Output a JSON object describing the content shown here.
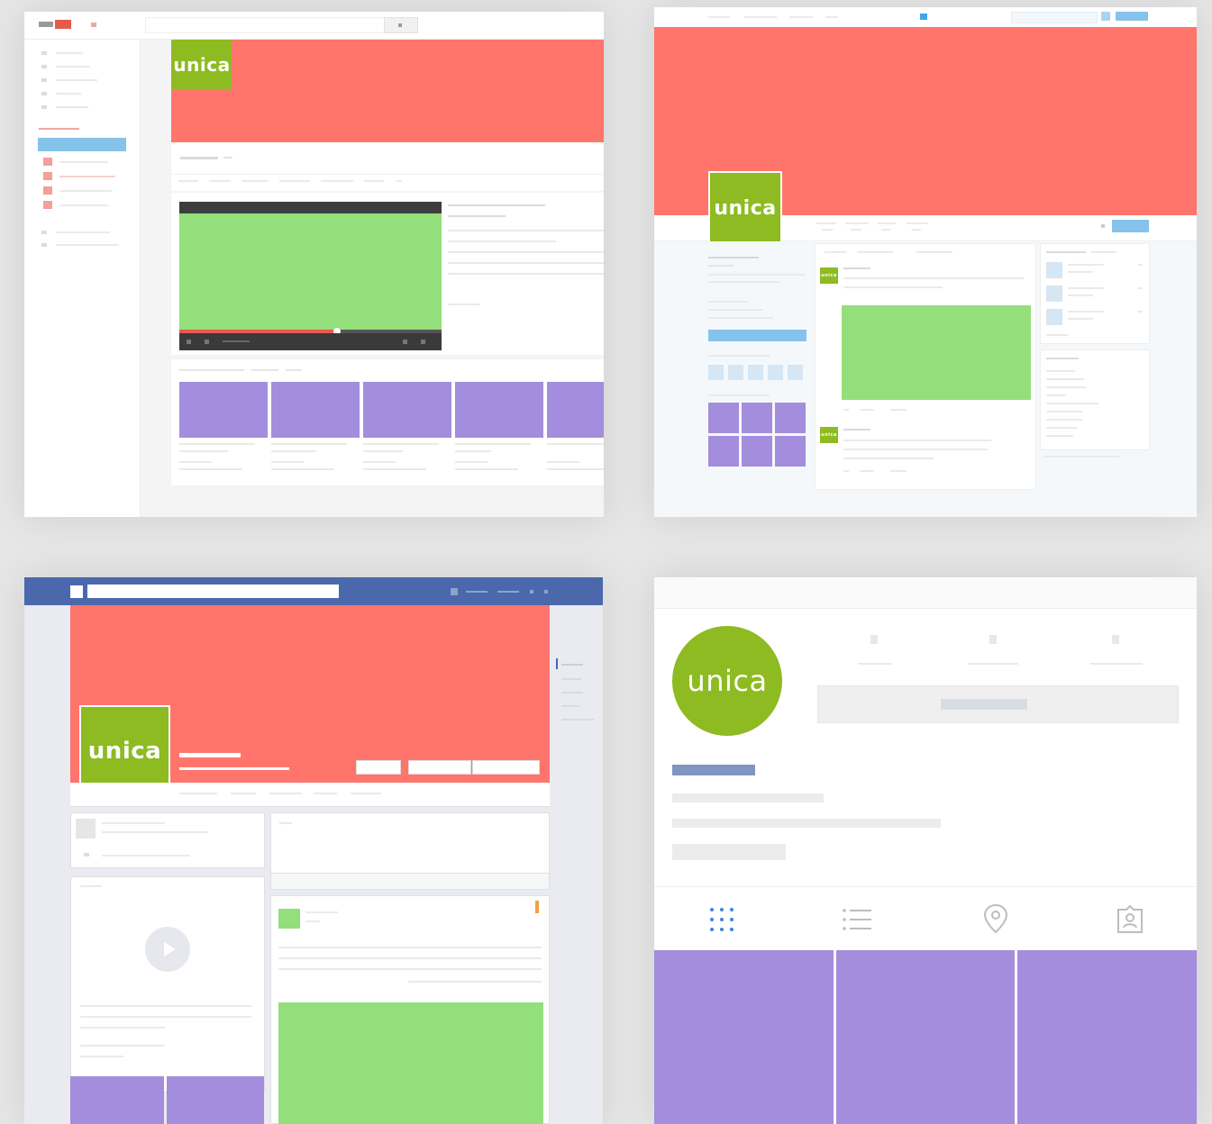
{
  "brand": {
    "logo_text": "unica",
    "colors": {
      "cover": "#ff756b",
      "logo_green": "#8dbb21",
      "media_green": "#93df7c",
      "thumb_purple": "#a38ddc",
      "fb_blue": "#4a68ab",
      "accent_blue": "#86c3ea",
      "tag_red": "#e85a4f"
    }
  },
  "panels": {
    "video_site": {
      "logo": "unica",
      "play_progress": 0.6
    },
    "social_network": {
      "logo": "unica"
    },
    "facebook_page": {
      "logo": "unica"
    },
    "instagram_profile": {
      "logo": "unica",
      "tabs": [
        {
          "icon": "grid-icon"
        },
        {
          "icon": "list-icon"
        },
        {
          "icon": "location-pin-icon"
        },
        {
          "icon": "tagged-user-icon"
        }
      ]
    }
  }
}
